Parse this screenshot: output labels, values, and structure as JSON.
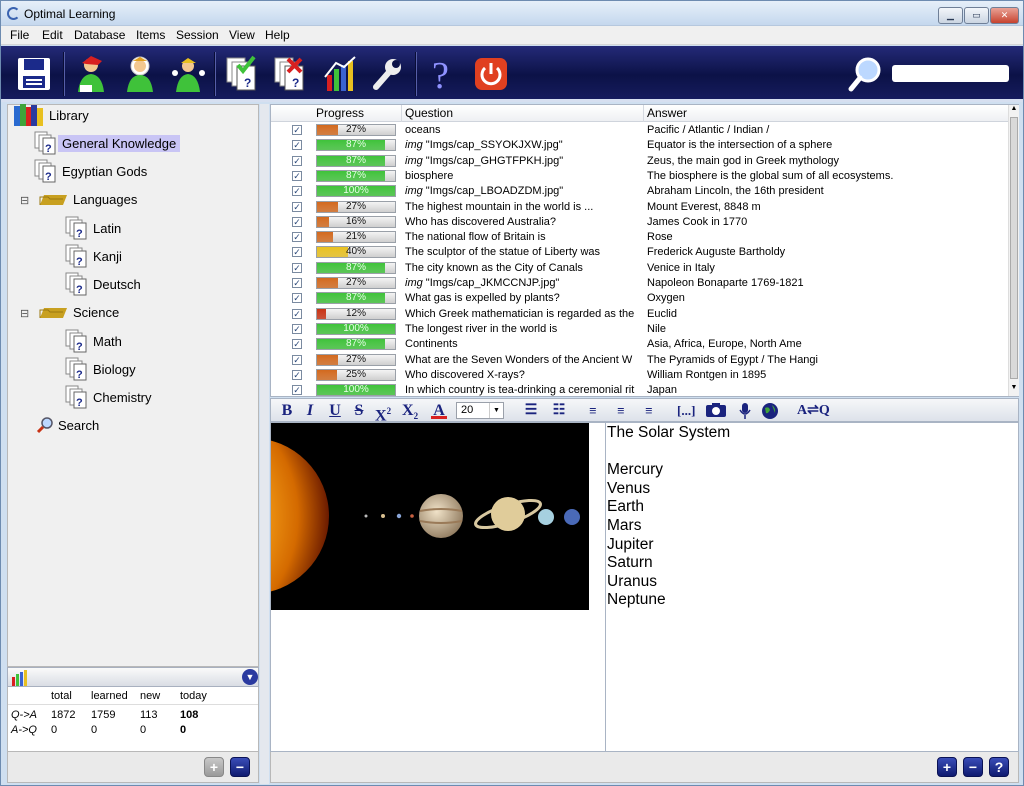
{
  "window": {
    "title": "Optimal Learning"
  },
  "menu": [
    "File",
    "Edit",
    "Database",
    "Items",
    "Session",
    "View",
    "Help"
  ],
  "toolbar": {
    "buttons": [
      "save-icon",
      "user-red-icon",
      "user-astronaut-icon",
      "user-group-icon",
      "learn-cards-icon",
      "review-cards-icon",
      "statistics-icon",
      "settings-wrench-icon",
      "help-icon",
      "power-icon"
    ],
    "search_value": ""
  },
  "tree": {
    "root": "Library",
    "items": [
      {
        "label": "General Knowledge",
        "selected": true
      },
      {
        "label": "Egyptian Gods"
      },
      {
        "label": "Languages",
        "children": [
          "Latin",
          "Kanji",
          "Deutsch"
        ]
      },
      {
        "label": "Science",
        "children": [
          "Math",
          "Biology",
          "Chemistry"
        ]
      },
      {
        "label": "Search"
      }
    ]
  },
  "stats": {
    "headers": [
      "total",
      "learned",
      "new",
      "today"
    ],
    "rows": [
      {
        "dir": "Q->A",
        "values": [
          "1872",
          "1759",
          "113",
          "108"
        ]
      },
      {
        "dir": "A->Q",
        "values": [
          "0",
          "0",
          "0",
          "0"
        ]
      }
    ]
  },
  "grid": {
    "headers": [
      "Progress",
      "Question",
      "Answer"
    ],
    "rows": [
      {
        "progress": 27,
        "question": "oceans",
        "answer": "Pacific / Atlantic / Indian /"
      },
      {
        "progress": 87,
        "img": true,
        "question": "\"Imgs/cap_SSYOKJXW.jpg\"",
        "answer": "Equator is the intersection of a sphere"
      },
      {
        "progress": 87,
        "img": true,
        "question": "\"Imgs/cap_GHGTFPKH.jpg\"",
        "answer": "Zeus, the main god in Greek mythology"
      },
      {
        "progress": 87,
        "question": "biosphere",
        "answer": "The biosphere is the global sum of all ecosystems."
      },
      {
        "progress": 100,
        "img": true,
        "question": "\"Imgs/cap_LBOADZDM.jpg\"",
        "answer": "Abraham Lincoln, the 16th president"
      },
      {
        "progress": 27,
        "question": "The highest mountain in the world is ...",
        "answer": "Mount Everest, 8848 m"
      },
      {
        "progress": 16,
        "question": "Who has discovered Australia?",
        "answer": "James Cook in 1770"
      },
      {
        "progress": 21,
        "question": "The national flow of Britain is",
        "answer": "Rose"
      },
      {
        "progress": 40,
        "question": "The sculptor of the statue of Liberty was",
        "answer": "Frederick Auguste Bartholdy"
      },
      {
        "progress": 87,
        "question": "The city known as the City of Canals",
        "answer": "Venice in Italy"
      },
      {
        "progress": 27,
        "img": true,
        "question": "\"Imgs/cap_JKMCCNJP.jpg\"",
        "answer": "Napoleon Bonaparte 1769-1821"
      },
      {
        "progress": 87,
        "question": "What gas is expelled by plants?",
        "answer": "Oxygen"
      },
      {
        "progress": 12,
        "question": "Which Greek mathematician is regarded as the",
        "answer": "Euclid"
      },
      {
        "progress": 100,
        "question": "The longest river in the world is",
        "answer": "Nile"
      },
      {
        "progress": 87,
        "question": "Continents",
        "answer": "Asia, Africa, Europe, North Ame"
      },
      {
        "progress": 27,
        "question": "What are the Seven Wonders of the Ancient W",
        "answer": "The Pyramids of Egypt / The Hangi"
      },
      {
        "progress": 25,
        "question": "Who discovered X-rays?",
        "answer": "William Rontgen in 1895"
      },
      {
        "progress": 100,
        "question": "In which country is tea-drinking a ceremonial rit",
        "answer": "Japan"
      }
    ]
  },
  "format": {
    "font_size": "20"
  },
  "preview": {
    "lines": [
      "The Solar System",
      "",
      "Mercury",
      "Venus",
      "Earth",
      "Mars",
      "Jupiter",
      "Saturn",
      "Uranus",
      "Neptune"
    ]
  },
  "colors": {
    "toolbar": "#0c1247",
    "progress_green": "#3fc23a",
    "progress_orange": "#d2691e",
    "progress_yellow": "#e8c020",
    "progress_red": "#c83214",
    "selection": "#c9c5f5"
  }
}
